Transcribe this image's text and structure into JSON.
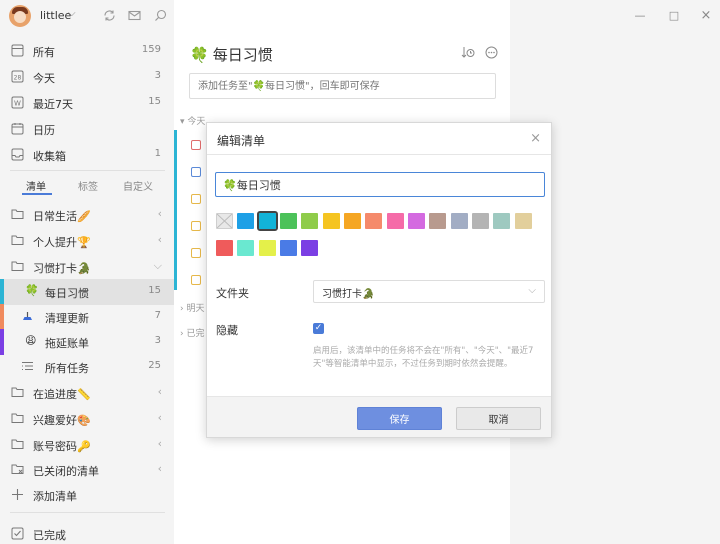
{
  "user": {
    "name": "littlee",
    "chevron": "⌵"
  },
  "header_icons": [
    "sync-icon",
    "mail-icon",
    "search-icon"
  ],
  "smart_lists": [
    {
      "label": "所有",
      "count": "159",
      "icon": "list-icon"
    },
    {
      "label": "今天",
      "count": "3",
      "icon": "calendar-day-icon",
      "glyph": "28"
    },
    {
      "label": "最近7天",
      "count": "15",
      "icon": "week-icon",
      "glyph": "W"
    },
    {
      "label": "日历",
      "count": "",
      "icon": "calendar-icon"
    },
    {
      "label": "收集箱",
      "count": "1",
      "icon": "inbox-icon"
    }
  ],
  "tabs": [
    "清单",
    "标签",
    "自定义"
  ],
  "folders": [
    {
      "label": "日常生活🥖",
      "arrow": "‹"
    },
    {
      "label": "个人提升🏆",
      "arrow": "‹"
    },
    {
      "label": "习惯打卡🐊",
      "arrow": "⌵"
    }
  ],
  "habit_lists": [
    {
      "label": "每日习惯",
      "count": "15",
      "emoji": "🍀",
      "strip": "#2cb4d4"
    },
    {
      "label": "清理更新",
      "count": "7",
      "emoji": "🧹",
      "strip": "#f08a5d"
    },
    {
      "label": "拖延账单",
      "count": "3",
      "emoji": "😩",
      "strip": "#7b3fe4"
    },
    {
      "label": "所有任务",
      "count": "25",
      "emoji": "",
      "strip": ""
    }
  ],
  "folders2": [
    {
      "label": "在追进度📏",
      "arrow": "‹"
    },
    {
      "label": "兴趣爱好🎨",
      "arrow": "‹"
    },
    {
      "label": "账号密码🔑",
      "arrow": "‹"
    },
    {
      "label": "已关闭的清单",
      "arrow": "‹"
    }
  ],
  "add_list": "添加清单",
  "completed": "已完成",
  "main": {
    "title": "每日习惯",
    "title_emoji": "🍀",
    "quick_add_placeholder": "添加任务至\"🍀每日习惯\"，回车即可保存",
    "sections": [
      "今天",
      "明天",
      "已完"
    ],
    "task_checkbox_colors": [
      "#e06c6c",
      "#5b8ad8",
      "#e6b84a",
      "#e6b84a",
      "#e6b84a",
      "#e6b84a"
    ]
  },
  "dialog": {
    "title": "编辑清单",
    "name_value": "🍀每日习惯",
    "colors_row1": [
      "none",
      "#1ea0e6",
      "#12b3d8",
      "#4cc25a",
      "#8fcc4a",
      "#f5c421",
      "#f5a623",
      "#f58a6b",
      "#f56ba8",
      "#d46ae0",
      "#b89a8e",
      "#a2adc4",
      "#b4b4b4",
      "#9ec9c0",
      "#e2cf9c"
    ],
    "colors_row2": [
      "#ef5b5b",
      "#6ae8d0",
      "#e4f04a",
      "#4a7be6",
      "#7b3fe4"
    ],
    "selected_color": "#12b3d8",
    "folder_label": "文件夹",
    "folder_value": "习惯打卡🐊",
    "hide_label": "隐藏",
    "hide_checked": "✓",
    "hint": "启用后，该清单中的任务将不会在\"所有\"、\"今天\"、\"最近7天\"等智能清单中显示，不过任务到期时依然会提醒。",
    "save": "保存",
    "cancel": "取消",
    "close": "×"
  },
  "window_controls": [
    "—",
    "□",
    "×"
  ]
}
